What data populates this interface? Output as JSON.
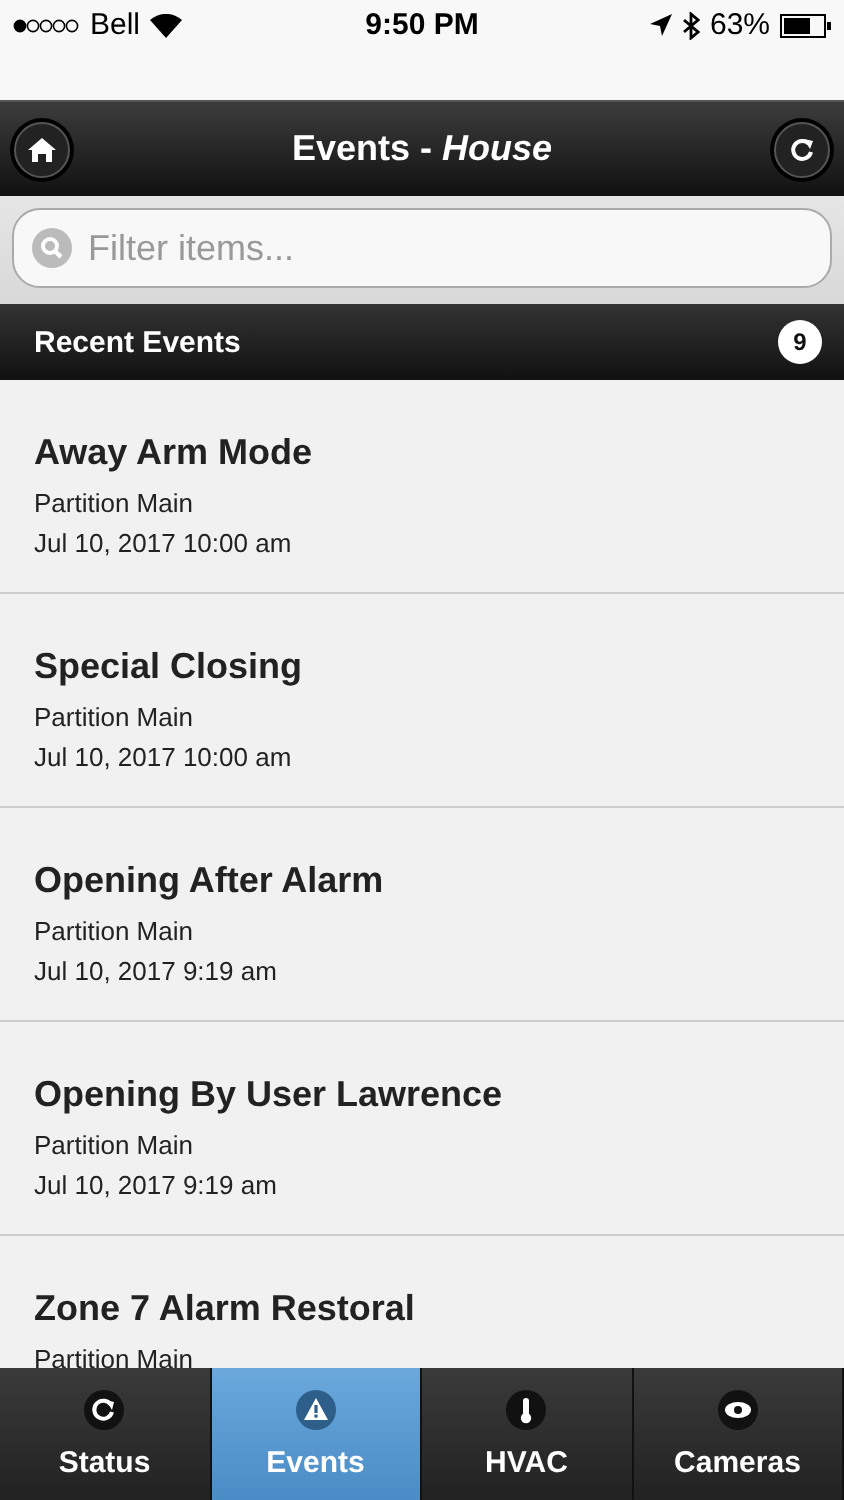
{
  "status_bar": {
    "carrier": "Bell",
    "time": "9:50 PM",
    "battery": "63%"
  },
  "header": {
    "title": "Events - *House*"
  },
  "search": {
    "placeholder": "Filter items..."
  },
  "list": {
    "title": "Recent Events",
    "count": "9",
    "items": [
      {
        "title": "Away Arm Mode",
        "subtitle": "Partition Main",
        "date": "Jul 10, 2017 10:00 am"
      },
      {
        "title": "Special Closing",
        "subtitle": "Partition Main",
        "date": "Jul 10, 2017 10:00 am"
      },
      {
        "title": "Opening After Alarm",
        "subtitle": "Partition Main",
        "date": "Jul 10, 2017 9:19 am"
      },
      {
        "title": "Opening By User Lawrence",
        "subtitle": "Partition Main",
        "date": "Jul 10, 2017 9:19 am"
      },
      {
        "title": "Zone 7 Alarm Restoral",
        "subtitle": "Partition Main"
      }
    ]
  },
  "tabs": [
    {
      "label": "Status",
      "kind": "refresh",
      "selected": false
    },
    {
      "label": "Events",
      "kind": "alert",
      "selected": true
    },
    {
      "label": "HVAC",
      "kind": "thermometer",
      "selected": false
    },
    {
      "label": "Cameras",
      "kind": "eye",
      "selected": false
    }
  ]
}
